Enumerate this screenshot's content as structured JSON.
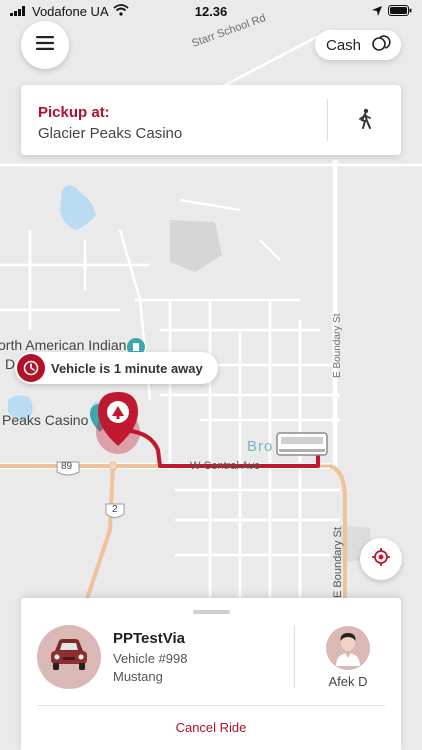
{
  "status_bar": {
    "carrier": "Vodafone UA",
    "time": "12.36"
  },
  "header": {
    "payment_label": "Cash"
  },
  "pickup": {
    "title": "Pickup at:",
    "location": "Glacier Peaks Casino"
  },
  "map": {
    "labels": {
      "school_road": "Starr School Rd",
      "museum": "orth American Indian",
      "museum_line2": "D",
      "casino": "Peaks Casino",
      "browning": "Bro",
      "central_ave": "W Central Ave",
      "boundary_st_upper": "E Boundary St",
      "boundary_st_lower": "E Boundary St",
      "route_89": "89",
      "route_2": "2"
    }
  },
  "eta": {
    "text": "Vehicle is 1 minute away"
  },
  "ride": {
    "vehicle_name": "PPTestVia",
    "vehicle_number": "Vehicle #998",
    "vehicle_model": "Mustang",
    "driver_name": "Afek D",
    "cancel_label": "Cancel Ride"
  },
  "colors": {
    "accent": "#b3102a",
    "route": "#c0182e",
    "map_background": "#eaeaea",
    "road": "#ffffff",
    "water": "#b9dcf2",
    "highway": "#f0c29a"
  }
}
